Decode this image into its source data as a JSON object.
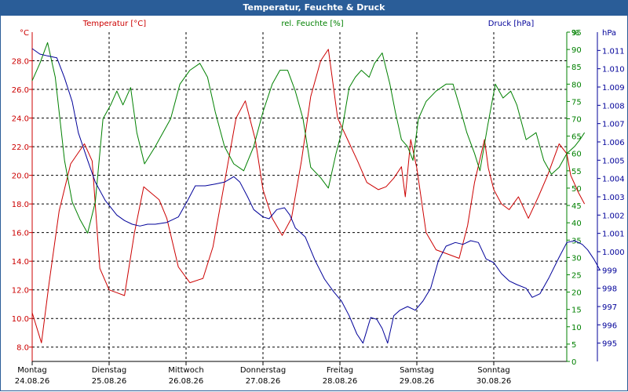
{
  "window": {
    "title": "Temperatur, Feuchte & Druck"
  },
  "chart_data": {
    "type": "line",
    "title": "Temperatur, Feuchte & Druck",
    "grid": true,
    "x": {
      "range": [
        0,
        7
      ],
      "ticks": [
        {
          "pos": 0,
          "day": "Montag",
          "date": "24.08.26"
        },
        {
          "pos": 1,
          "day": "Dienstag",
          "date": "25.08.26"
        },
        {
          "pos": 2,
          "day": "Mittwoch",
          "date": "26.08.26"
        },
        {
          "pos": 3,
          "day": "Donnerstag",
          "date": "27.08.26"
        },
        {
          "pos": 4,
          "day": "Freitag",
          "date": "28.08.26"
        },
        {
          "pos": 5,
          "day": "Samstag",
          "date": "29.08.26"
        },
        {
          "pos": 6,
          "day": "Sonntag",
          "date": "30.08.26"
        }
      ]
    },
    "axes": {
      "temperature": {
        "unit": "°C",
        "range": [
          7,
          30
        ],
        "ticks": [
          "8.0",
          "10.0",
          "12.0",
          "14.0",
          "16.0",
          "18.0",
          "20.0",
          "22.0",
          "24.0",
          "26.0",
          "28.0"
        ],
        "color": "#cc0000"
      },
      "humidity": {
        "unit": "%",
        "range": [
          0,
          95
        ],
        "ticks": [
          "0",
          "5",
          "10",
          "15",
          "20",
          "25",
          "30",
          "35",
          "40",
          "45",
          "50",
          "55",
          "60",
          "65",
          "70",
          "75",
          "80",
          "85",
          "90",
          "95"
        ],
        "color": "#008000"
      },
      "pressure": {
        "unit": "hPa",
        "range": [
          994,
          1012
        ],
        "ticks": [
          "995",
          "996",
          "997",
          "998",
          "999",
          "1.000",
          "1.001",
          "1.002",
          "1.003",
          "1.004",
          "1.005",
          "1.006",
          "1.007",
          "1.008",
          "1.009",
          "1.010",
          "1.011"
        ],
        "color": "#000099"
      }
    },
    "series": [
      {
        "name": "Temperatur [°C]",
        "color": "#cc0000",
        "axis": "temperature",
        "points": [
          [
            0,
            10.4
          ],
          [
            0.12,
            8.3
          ],
          [
            0.22,
            12.5
          ],
          [
            0.35,
            17.5
          ],
          [
            0.5,
            20.8
          ],
          [
            0.68,
            22.2
          ],
          [
            0.78,
            21.0
          ],
          [
            0.88,
            13.5
          ],
          [
            1.0,
            12.0
          ],
          [
            1.1,
            11.8
          ],
          [
            1.2,
            11.6
          ],
          [
            1.33,
            16.0
          ],
          [
            1.45,
            19.2
          ],
          [
            1.65,
            18.3
          ],
          [
            1.75,
            17.0
          ],
          [
            1.9,
            13.6
          ],
          [
            2.05,
            12.5
          ],
          [
            2.22,
            12.8
          ],
          [
            2.35,
            15.0
          ],
          [
            2.5,
            19.5
          ],
          [
            2.65,
            24.0
          ],
          [
            2.77,
            25.2
          ],
          [
            2.9,
            22.5
          ],
          [
            3.0,
            19.0
          ],
          [
            3.12,
            17.0
          ],
          [
            3.25,
            15.8
          ],
          [
            3.37,
            17.0
          ],
          [
            3.5,
            21.0
          ],
          [
            3.62,
            25.5
          ],
          [
            3.75,
            28.0
          ],
          [
            3.85,
            28.8
          ],
          [
            3.97,
            24.0
          ],
          [
            4.1,
            22.5
          ],
          [
            4.23,
            21.0
          ],
          [
            4.35,
            19.5
          ],
          [
            4.5,
            19.0
          ],
          [
            4.6,
            19.2
          ],
          [
            4.7,
            19.8
          ],
          [
            4.8,
            20.6
          ],
          [
            4.85,
            18.5
          ],
          [
            4.92,
            22.5
          ],
          [
            5.0,
            20.5
          ],
          [
            5.12,
            16.0
          ],
          [
            5.25,
            14.8
          ],
          [
            5.4,
            14.5
          ],
          [
            5.55,
            14.2
          ],
          [
            5.66,
            16.5
          ],
          [
            5.75,
            19.5
          ],
          [
            5.88,
            22.5
          ],
          [
            5.93,
            20.5
          ],
          [
            6.0,
            19.0
          ],
          [
            6.1,
            18.0
          ],
          [
            6.2,
            17.6
          ],
          [
            6.32,
            18.5
          ],
          [
            6.45,
            17.0
          ],
          [
            6.58,
            18.5
          ],
          [
            6.7,
            20.0
          ],
          [
            6.85,
            22.2
          ],
          [
            6.95,
            21.5
          ],
          [
            7.0,
            20.0
          ],
          [
            7.1,
            18.8
          ],
          [
            7.18,
            18.0
          ]
        ]
      },
      {
        "name": "rel. Feuchte [%]",
        "color": "#008000",
        "axis": "humidity",
        "points": [
          [
            0,
            81
          ],
          [
            0.1,
            86
          ],
          [
            0.2,
            92
          ],
          [
            0.3,
            82
          ],
          [
            0.42,
            58
          ],
          [
            0.52,
            46
          ],
          [
            0.62,
            41
          ],
          [
            0.72,
            37
          ],
          [
            0.82,
            46
          ],
          [
            0.92,
            70
          ],
          [
            1.02,
            74
          ],
          [
            1.1,
            78
          ],
          [
            1.18,
            74
          ],
          [
            1.28,
            79
          ],
          [
            1.36,
            66
          ],
          [
            1.46,
            57
          ],
          [
            1.6,
            62
          ],
          [
            1.8,
            70
          ],
          [
            1.92,
            80
          ],
          [
            2.05,
            84
          ],
          [
            2.18,
            86
          ],
          [
            2.28,
            82
          ],
          [
            2.38,
            72
          ],
          [
            2.5,
            62
          ],
          [
            2.62,
            57
          ],
          [
            2.75,
            55
          ],
          [
            2.88,
            62
          ],
          [
            3.0,
            72
          ],
          [
            3.12,
            80
          ],
          [
            3.22,
            84
          ],
          [
            3.32,
            84
          ],
          [
            3.42,
            78
          ],
          [
            3.52,
            70
          ],
          [
            3.62,
            56
          ],
          [
            3.75,
            53
          ],
          [
            3.85,
            50
          ],
          [
            3.95,
            60
          ],
          [
            4.02,
            66
          ],
          [
            4.12,
            79
          ],
          [
            4.2,
            82
          ],
          [
            4.28,
            84
          ],
          [
            4.38,
            82
          ],
          [
            4.45,
            86
          ],
          [
            4.55,
            89
          ],
          [
            4.65,
            80
          ],
          [
            4.72,
            72
          ],
          [
            4.8,
            64
          ],
          [
            4.88,
            62
          ],
          [
            4.95,
            58
          ],
          [
            5.02,
            70
          ],
          [
            5.12,
            75
          ],
          [
            5.25,
            78
          ],
          [
            5.38,
            80
          ],
          [
            5.47,
            80
          ],
          [
            5.55,
            74
          ],
          [
            5.65,
            66
          ],
          [
            5.75,
            60
          ],
          [
            5.82,
            55
          ],
          [
            5.92,
            68
          ],
          [
            6.02,
            80
          ],
          [
            6.12,
            76
          ],
          [
            6.22,
            78
          ],
          [
            6.3,
            74
          ],
          [
            6.42,
            64
          ],
          [
            6.55,
            66
          ],
          [
            6.65,
            58
          ],
          [
            6.75,
            54
          ],
          [
            6.85,
            56
          ],
          [
            6.95,
            60
          ],
          [
            7.05,
            62
          ],
          [
            7.12,
            64
          ],
          [
            7.18,
            66
          ]
        ]
      },
      {
        "name": "Druck [hPa]",
        "color": "#000099",
        "axis": "pressure",
        "points": [
          [
            0,
            1011.1
          ],
          [
            0.1,
            1010.8
          ],
          [
            0.2,
            1010.7
          ],
          [
            0.32,
            1010.6
          ],
          [
            0.42,
            1009.5
          ],
          [
            0.52,
            1008.2
          ],
          [
            0.6,
            1006.5
          ],
          [
            0.72,
            1005.0
          ],
          [
            0.82,
            1003.8
          ],
          [
            0.95,
            1002.8
          ],
          [
            1.1,
            1002.0
          ],
          [
            1.2,
            1001.7
          ],
          [
            1.3,
            1001.5
          ],
          [
            1.4,
            1001.4
          ],
          [
            1.5,
            1001.5
          ],
          [
            1.6,
            1001.5
          ],
          [
            1.75,
            1001.6
          ],
          [
            1.9,
            1001.9
          ],
          [
            2.02,
            1002.8
          ],
          [
            2.12,
            1003.6
          ],
          [
            2.25,
            1003.6
          ],
          [
            2.38,
            1003.7
          ],
          [
            2.5,
            1003.8
          ],
          [
            2.62,
            1004.1
          ],
          [
            2.7,
            1003.8
          ],
          [
            2.8,
            1003.0
          ],
          [
            2.88,
            1002.3
          ],
          [
            3.0,
            1001.9
          ],
          [
            3.08,
            1001.8
          ],
          [
            3.18,
            1002.3
          ],
          [
            3.28,
            1002.4
          ],
          [
            3.35,
            1002.0
          ],
          [
            3.42,
            1001.3
          ],
          [
            3.55,
            1000.8
          ],
          [
            3.68,
            999.5
          ],
          [
            3.8,
            998.5
          ],
          [
            3.92,
            997.8
          ],
          [
            4.02,
            997.3
          ],
          [
            4.12,
            996.5
          ],
          [
            4.22,
            995.5
          ],
          [
            4.3,
            995.0
          ],
          [
            4.4,
            996.4
          ],
          [
            4.48,
            996.3
          ],
          [
            4.55,
            995.8
          ],
          [
            4.62,
            995.0
          ],
          [
            4.7,
            996.5
          ],
          [
            4.78,
            996.8
          ],
          [
            4.88,
            997.0
          ],
          [
            4.98,
            996.8
          ],
          [
            5.08,
            997.3
          ],
          [
            5.18,
            998.0
          ],
          [
            5.28,
            999.5
          ],
          [
            5.38,
            1000.3
          ],
          [
            5.5,
            1000.5
          ],
          [
            5.6,
            1000.4
          ],
          [
            5.7,
            1000.6
          ],
          [
            5.8,
            1000.5
          ],
          [
            5.9,
            999.6
          ],
          [
            6.0,
            999.4
          ],
          [
            6.1,
            998.8
          ],
          [
            6.2,
            998.4
          ],
          [
            6.3,
            998.2
          ],
          [
            6.42,
            998.0
          ],
          [
            6.5,
            997.5
          ],
          [
            6.6,
            997.7
          ],
          [
            6.72,
            998.6
          ],
          [
            6.85,
            999.7
          ],
          [
            6.95,
            1000.5
          ],
          [
            7.05,
            1000.6
          ],
          [
            7.15,
            1000.4
          ],
          [
            7.22,
            1000.1
          ],
          [
            7.3,
            999.6
          ],
          [
            7.38,
            999.0
          ]
        ]
      }
    ]
  }
}
